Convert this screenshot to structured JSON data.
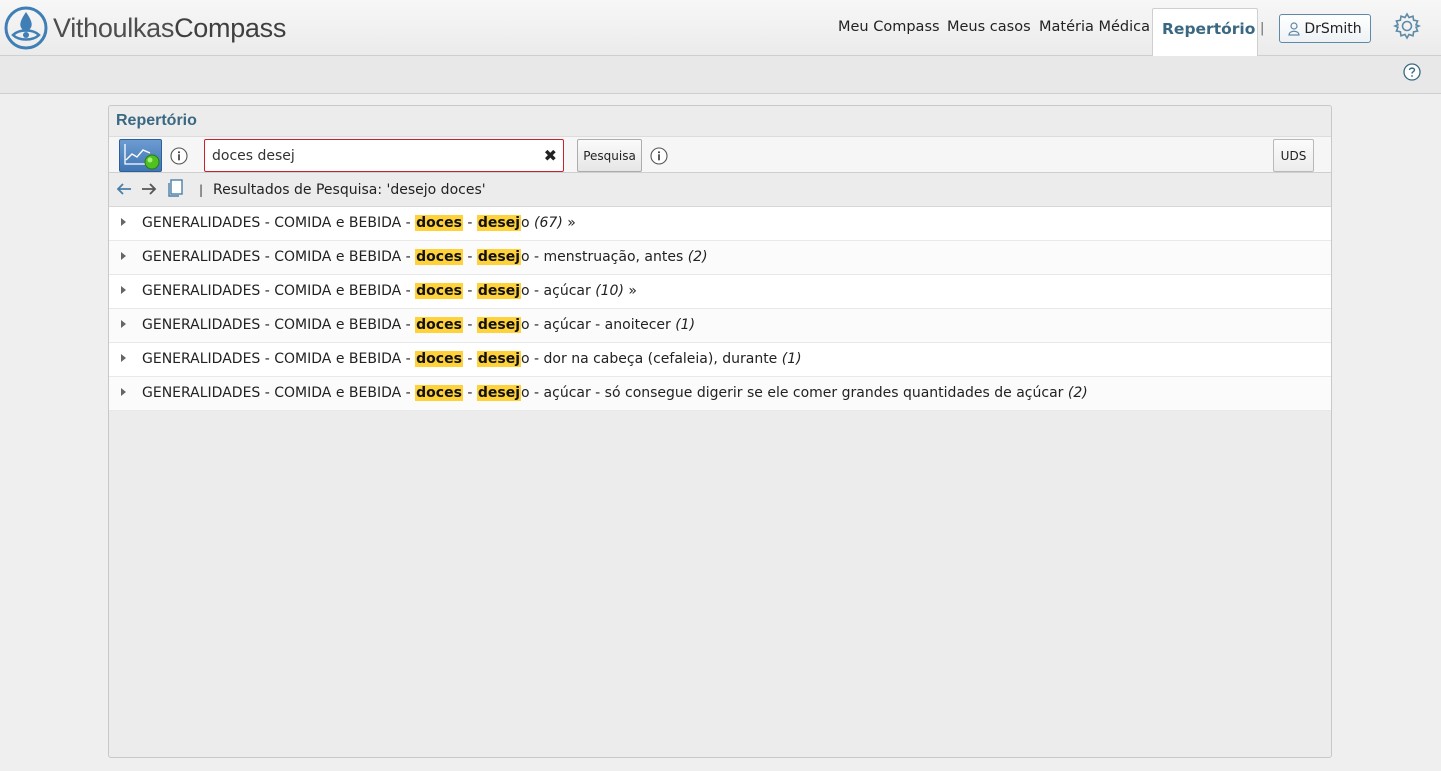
{
  "app": {
    "logo_part1": "Vithoulkas",
    "logo_part2": "Compass"
  },
  "nav": {
    "items": [
      "Meu Compass",
      "Meus casos",
      "Matéria Médica"
    ],
    "active": "Repertório",
    "separator": "|",
    "user": "DrSmith"
  },
  "panel": {
    "title": "Repertório"
  },
  "search": {
    "value": "doces desej",
    "button": "Pesquisa",
    "uds": "UDS",
    "clear_glyph": "✖"
  },
  "results_header": {
    "pipe": "|",
    "text": "Resultados de Pesquisa: 'desejo doces'"
  },
  "results": [
    {
      "prefix": "GENERALIDADES - COMIDA e BEBIDA - ",
      "hl1": "doces",
      "sep": " - ",
      "hl2": "desej",
      "rest": "o ",
      "count": "(67)",
      "more": " »"
    },
    {
      "prefix": "GENERALIDADES - COMIDA e BEBIDA - ",
      "hl1": "doces",
      "sep": " - ",
      "hl2": "desej",
      "rest": "o - menstruação, antes ",
      "count": "(2)",
      "more": ""
    },
    {
      "prefix": "GENERALIDADES - COMIDA e BEBIDA - ",
      "hl1": "doces",
      "sep": " - ",
      "hl2": "desej",
      "rest": "o - açúcar ",
      "count": "(10)",
      "more": " »"
    },
    {
      "prefix": "GENERALIDADES - COMIDA e BEBIDA - ",
      "hl1": "doces",
      "sep": " - ",
      "hl2": "desej",
      "rest": "o - açúcar - anoitecer ",
      "count": "(1)",
      "more": ""
    },
    {
      "prefix": "GENERALIDADES - COMIDA e BEBIDA - ",
      "hl1": "doces",
      "sep": " - ",
      "hl2": "desej",
      "rest": "o - dor na cabeça (cefaleia), durante ",
      "count": "(1)",
      "more": ""
    },
    {
      "prefix": "GENERALIDADES - COMIDA e BEBIDA - ",
      "hl1": "doces",
      "sep": " - ",
      "hl2": "desej",
      "rest": "o - açúcar - só consegue digerir se ele comer grandes quantidades de açúcar ",
      "count": "(2)",
      "more": ""
    }
  ],
  "colors": {
    "accent": "#3a6882",
    "highlight": "#ffd23a",
    "search_border": "#c9212d"
  }
}
